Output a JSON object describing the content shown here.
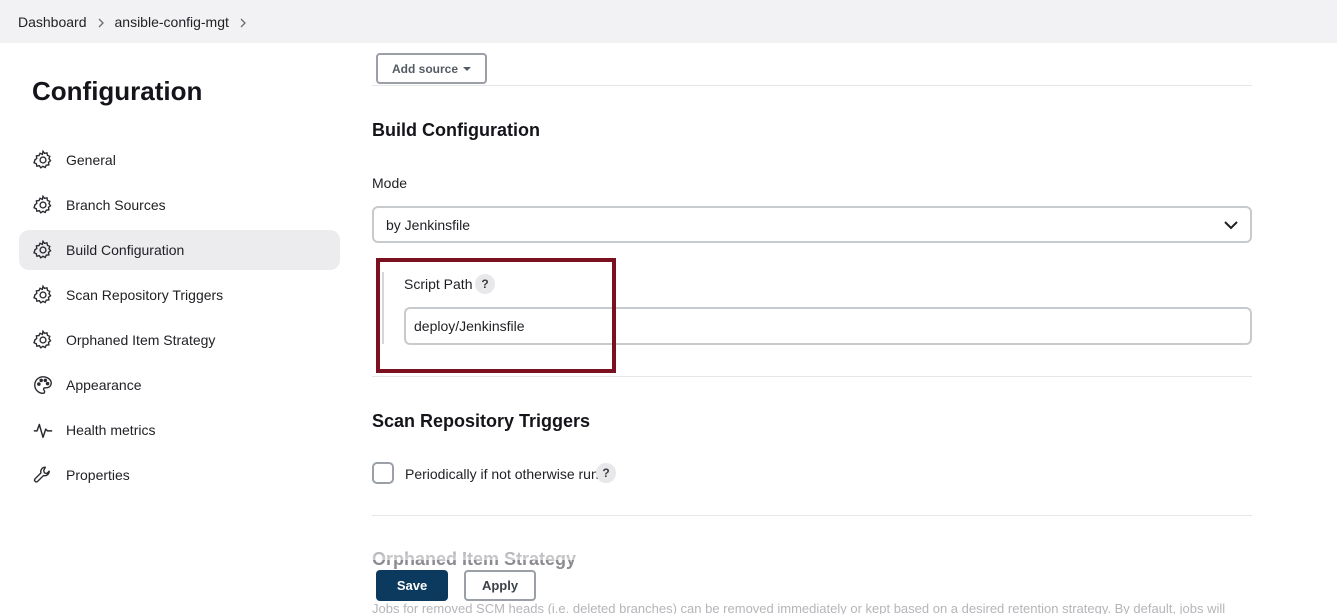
{
  "breadcrumb": {
    "items": [
      "Dashboard",
      "ansible-config-mgt"
    ]
  },
  "sidebar": {
    "title": "Configuration",
    "items": [
      {
        "label": "General",
        "icon": "gear-icon"
      },
      {
        "label": "Branch Sources",
        "icon": "gear-icon"
      },
      {
        "label": "Build Configuration",
        "icon": "gear-icon",
        "active": true
      },
      {
        "label": "Scan Repository Triggers",
        "icon": "gear-icon"
      },
      {
        "label": "Orphaned Item Strategy",
        "icon": "gear-icon"
      },
      {
        "label": "Appearance",
        "icon": "palette-icon"
      },
      {
        "label": "Health metrics",
        "icon": "pulse-icon"
      },
      {
        "label": "Properties",
        "icon": "wrench-icon"
      }
    ]
  },
  "main": {
    "add_source_label": "Add source",
    "build_config": {
      "title": "Build Configuration",
      "mode_label": "Mode",
      "mode_value": "by Jenkinsfile",
      "script_path_label": "Script Path",
      "script_path_value": "deploy/Jenkinsfile",
      "help_glyph": "?"
    },
    "scan_triggers": {
      "title": "Scan Repository Triggers",
      "checkbox_label": "Periodically if not otherwise run",
      "checked": false,
      "help_glyph": "?"
    },
    "orphaned": {
      "title": "Orphaned Item Strategy",
      "description": "Jobs for removed SCM heads (i.e. deleted branches) can be removed immediately or kept based on a desired retention strategy. By default, jobs will"
    }
  },
  "footer": {
    "save_label": "Save",
    "apply_label": "Apply"
  },
  "colors": {
    "highlight_border": "#7a1020",
    "save_button": "#0b3a5e",
    "active_item_bg": "#ececef"
  }
}
